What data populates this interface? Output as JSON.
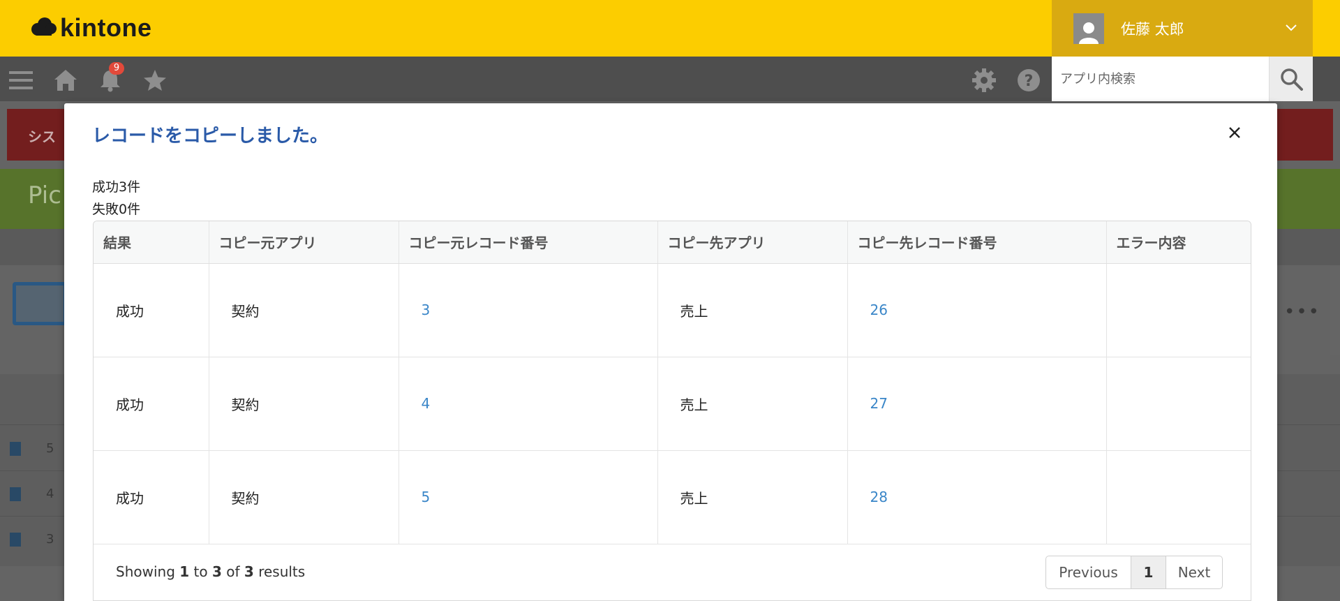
{
  "header": {
    "logo_text": "kintone",
    "user_name": "佐藤 太郎"
  },
  "nav": {
    "notification_count": "9",
    "search_placeholder": "アプリ内検索"
  },
  "background": {
    "red_banner_text": "シス",
    "app_title_partial": "Pic",
    "rows": [
      "5",
      "4",
      "3"
    ]
  },
  "modal": {
    "title": "レコードをコピーしました。",
    "success_text": "成功3件",
    "failure_text": "失敗0件",
    "table": {
      "headers": [
        "結果",
        "コピー元アプリ",
        "コピー元レコード番号",
        "コピー先アプリ",
        "コピー先レコード番号",
        "エラー内容"
      ],
      "rows": [
        {
          "result": "成功",
          "source_app": "契約",
          "source_record": "3",
          "dest_app": "売上",
          "dest_record": "26",
          "error": ""
        },
        {
          "result": "成功",
          "source_app": "契約",
          "source_record": "4",
          "dest_app": "売上",
          "dest_record": "27",
          "error": ""
        },
        {
          "result": "成功",
          "source_app": "契約",
          "source_record": "5",
          "dest_app": "売上",
          "dest_record": "28",
          "error": ""
        }
      ]
    },
    "footer": {
      "showing_prefix": "Showing",
      "from": "1",
      "to_word": "to",
      "to": "3",
      "of_word": "of",
      "total": "3",
      "results_word": "results",
      "prev_label": "Previous",
      "current_page": "1",
      "next_label": "Next"
    }
  },
  "colors": {
    "header_yellow": "#fccd00",
    "user_box": "#d9aa11",
    "navbar": "#4e4e4e",
    "title_blue": "#2a5aa8",
    "link_blue": "#3a86c8",
    "badge_red": "#e2493a"
  },
  "icons": [
    "kintone-cloud-icon",
    "user-avatar-icon",
    "chevron-down-icon",
    "menu-icon",
    "home-icon",
    "bell-icon",
    "star-icon",
    "gear-icon",
    "help-icon",
    "search-icon",
    "close-icon"
  ]
}
